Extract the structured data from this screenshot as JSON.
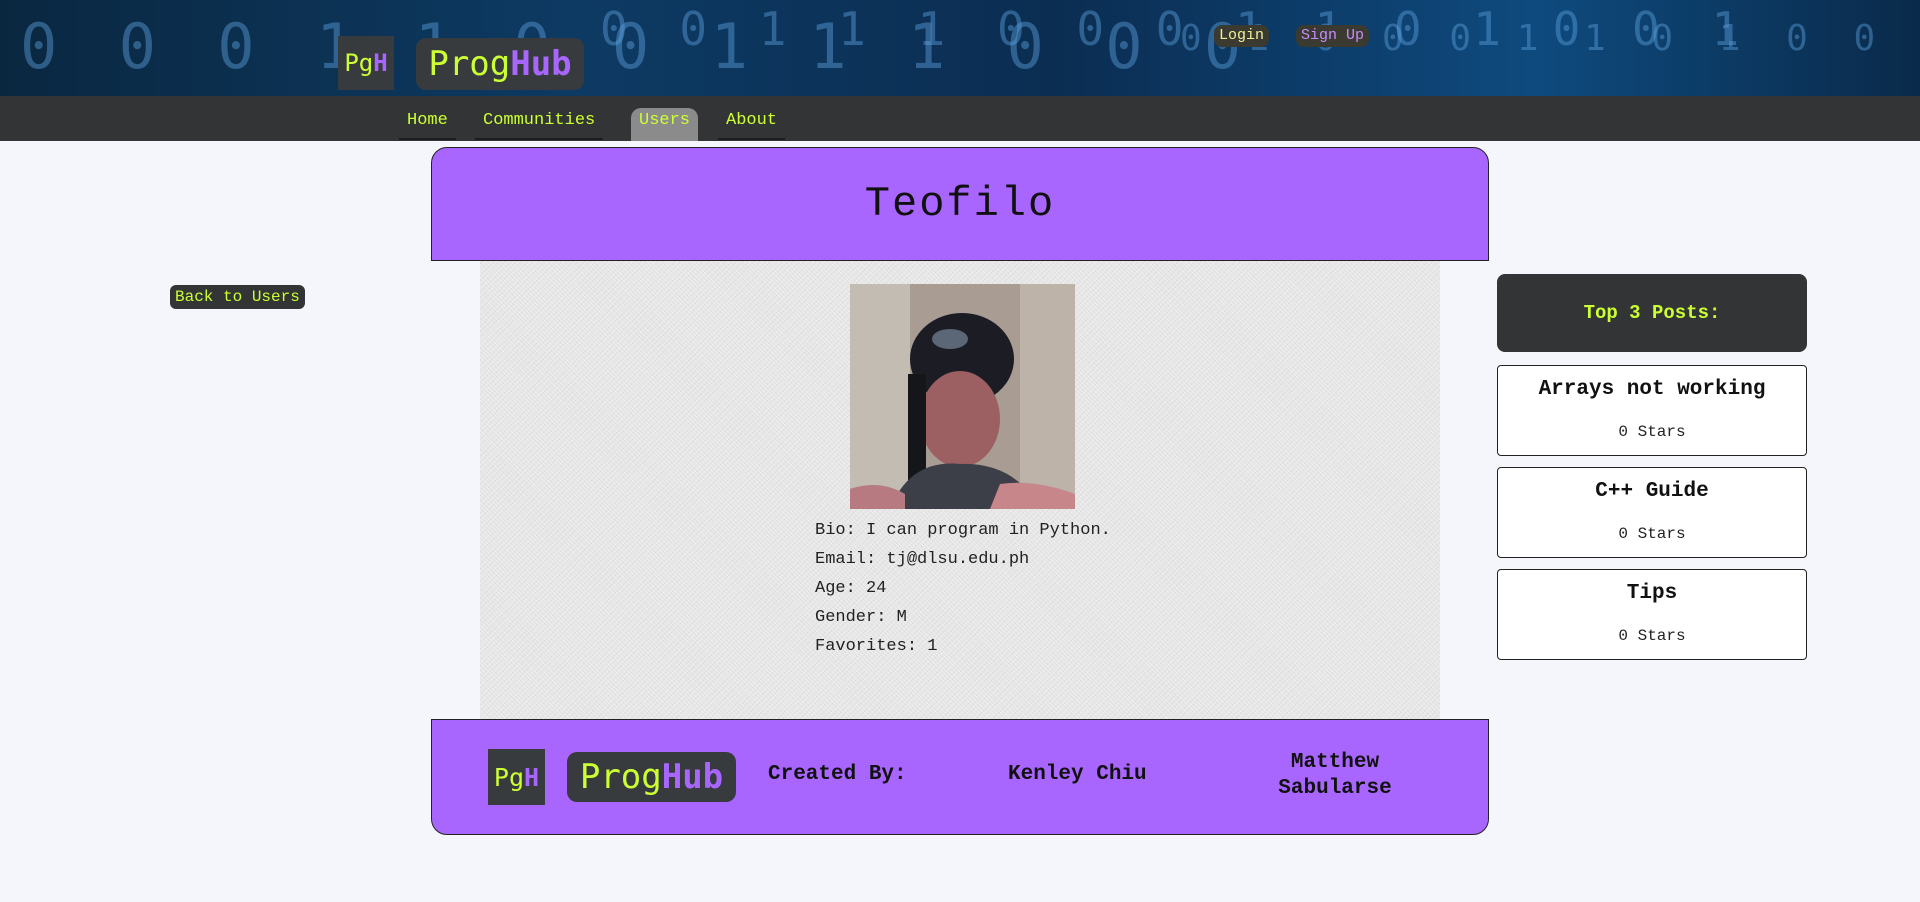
{
  "header": {
    "logo_mark": {
      "left": "Pg",
      "right": "H"
    },
    "logo_text": {
      "left": "Prog",
      "right": "Hub"
    },
    "login_label": "Login",
    "signup_label": "Sign Up",
    "binary_rows": [
      "0 0 0 1 1 0 0 1 1 1 0 0 0",
      "0 0 1 1 1 0 0 0 1 1 0 1 0 0 1",
      "0 1 0 0 0 1 1 0 1 0 0 0 1 1 1"
    ]
  },
  "nav": {
    "items": [
      {
        "label": "Home"
      },
      {
        "label": "Communities"
      },
      {
        "label": "Users",
        "active": true
      },
      {
        "label": "About"
      }
    ]
  },
  "back_button": "Back to Users",
  "profile": {
    "name": "Teofilo",
    "bio": "Bio: I can program in Python.",
    "email": "Email: tj@dlsu.edu.ph",
    "age": "Age: 24",
    "gender": "Gender: M",
    "favorites": "Favorites: 1"
  },
  "top_posts": {
    "heading": "Top 3 Posts:",
    "items": [
      {
        "title": "Arrays not working",
        "stars": "0 Stars"
      },
      {
        "title": "C++ Guide",
        "stars": "0 Stars"
      },
      {
        "title": "Tips",
        "stars": "0 Stars"
      }
    ]
  },
  "footer": {
    "created_by": "Created By:",
    "author_1": "Kenley Chiu",
    "author_2": "Matthew Sabularse"
  },
  "colors": {
    "accent_purple": "#a966ff",
    "accent_lime": "#ccff33",
    "dark": "#333435"
  }
}
